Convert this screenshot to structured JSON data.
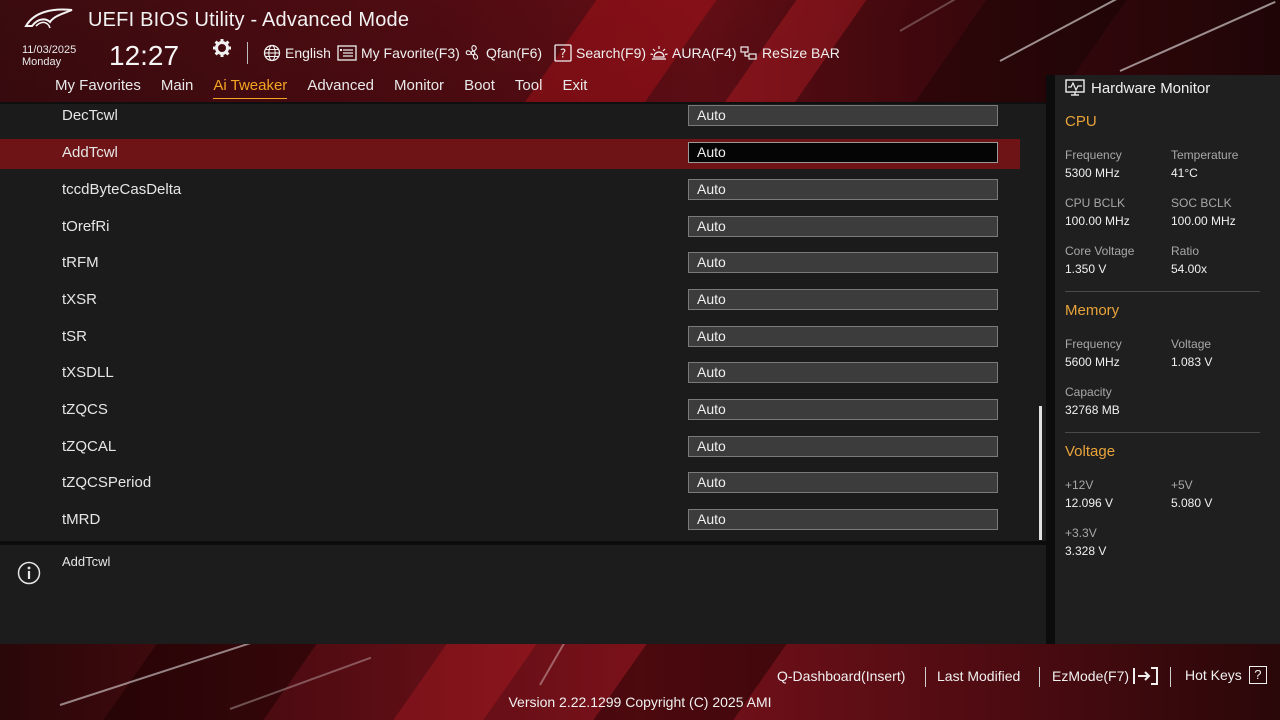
{
  "header": {
    "title": "UEFI BIOS Utility - Advanced Mode",
    "date": "11/03/2025",
    "day": "Monday",
    "time": "12:27",
    "toolbar": {
      "language": "English",
      "my_favorite": "My Favorite(F3)",
      "qfan": "Qfan(F6)",
      "search": "Search(F9)",
      "aura": "AURA(F4)",
      "resize_bar": "ReSize BAR"
    }
  },
  "tabs": [
    {
      "label": "My Favorites",
      "active": false
    },
    {
      "label": "Main",
      "active": false
    },
    {
      "label": "Ai Tweaker",
      "active": true
    },
    {
      "label": "Advanced",
      "active": false
    },
    {
      "label": "Monitor",
      "active": false
    },
    {
      "label": "Boot",
      "active": false
    },
    {
      "label": "Tool",
      "active": false
    },
    {
      "label": "Exit",
      "active": false
    }
  ],
  "settings": [
    {
      "label": "DecTcwl",
      "value": "Auto",
      "selected": false
    },
    {
      "label": "AddTcwl",
      "value": "Auto",
      "selected": true
    },
    {
      "label": "tccdByteCasDelta",
      "value": "Auto",
      "selected": false
    },
    {
      "label": "tOrefRi",
      "value": "Auto",
      "selected": false
    },
    {
      "label": "tRFM",
      "value": "Auto",
      "selected": false
    },
    {
      "label": "tXSR",
      "value": "Auto",
      "selected": false
    },
    {
      "label": "tSR",
      "value": "Auto",
      "selected": false
    },
    {
      "label": "tXSDLL",
      "value": "Auto",
      "selected": false
    },
    {
      "label": "tZQCS",
      "value": "Auto",
      "selected": false
    },
    {
      "label": "tZQCAL",
      "value": "Auto",
      "selected": false
    },
    {
      "label": "tZQCSPeriod",
      "value": "Auto",
      "selected": false
    },
    {
      "label": "tMRD",
      "value": "Auto",
      "selected": false
    }
  ],
  "help": {
    "text": "AddTcwl"
  },
  "hardware_monitor": {
    "title": "Hardware Monitor",
    "cpu": {
      "heading": "CPU",
      "frequency_label": "Frequency",
      "frequency": "5300 MHz",
      "temperature_label": "Temperature",
      "temperature": "41°C",
      "cpu_bclk_label": "CPU BCLK",
      "cpu_bclk": "100.00 MHz",
      "soc_bclk_label": "SOC BCLK",
      "soc_bclk": "100.00 MHz",
      "core_voltage_label": "Core Voltage",
      "core_voltage": "1.350 V",
      "ratio_label": "Ratio",
      "ratio": "54.00x"
    },
    "memory": {
      "heading": "Memory",
      "frequency_label": "Frequency",
      "frequency": "5600 MHz",
      "voltage_label": "Voltage",
      "voltage": "1.083 V",
      "capacity_label": "Capacity",
      "capacity": "32768 MB"
    },
    "voltage": {
      "heading": "Voltage",
      "v12_label": "+12V",
      "v12": "12.096 V",
      "v5_label": "+5V",
      "v5": "5.080 V",
      "v33_label": "+3.3V",
      "v33": "3.328 V"
    }
  },
  "footer": {
    "q_dashboard": "Q-Dashboard(Insert)",
    "last_modified": "Last Modified",
    "ezmode": "EzMode(F7)",
    "hot_keys": "Hot Keys",
    "hot_keys_key": "?",
    "version": "Version 2.22.1299 Copyright (C) 2025 AMI"
  },
  "colors": {
    "accent": "#f5a623",
    "selected_row": "#6e1416",
    "section_heading": "#e8a33a"
  }
}
